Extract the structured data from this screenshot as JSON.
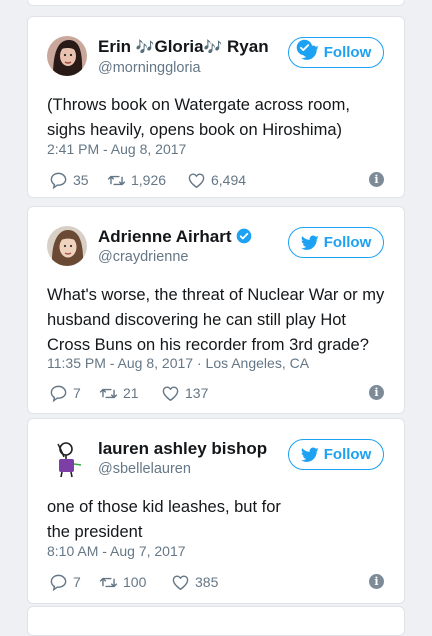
{
  "colors": {
    "accent": "#1da1f2",
    "muted": "#657786",
    "text": "#14171a",
    "background": "#eef0f3"
  },
  "follow_label": "Follow",
  "tweets": [
    {
      "name_parts": [
        "Erin ",
        "🎶",
        "Gloria",
        "🎶",
        " Ryan"
      ],
      "handle": "@morninggloria",
      "verified": true,
      "avatar": "photo-avatar-dark-hair",
      "text": "(Throws book on Watergate across room, sighs heavily, opens book on Hiroshima)",
      "time": "2:41 PM - Aug 8, 2017",
      "location": "",
      "replies": "35",
      "retweets": "1,926",
      "likes": "6,494"
    },
    {
      "name": "Adrienne Airhart",
      "handle": "@craydrienne",
      "verified": true,
      "avatar": "photo-avatar-brown-hair",
      "text": "What's worse, the threat of Nuclear War or my husband discovering he can still play Hot Cross Buns on his recorder from 3rd grade?",
      "time": "11:35 PM - Aug 8, 2017",
      "location": "Los Angeles, CA",
      "replies": "7",
      "retweets": "21",
      "likes": "137"
    },
    {
      "name": "lauren ashley bishop",
      "handle": "@sbellelauren",
      "verified": false,
      "avatar": "drawn-figure-avatar",
      "text": "one of those kid leashes, but for the president",
      "time": "8:10 AM - Aug 7, 2017",
      "location": "",
      "replies": "7",
      "retweets": "100",
      "likes": "385"
    }
  ]
}
